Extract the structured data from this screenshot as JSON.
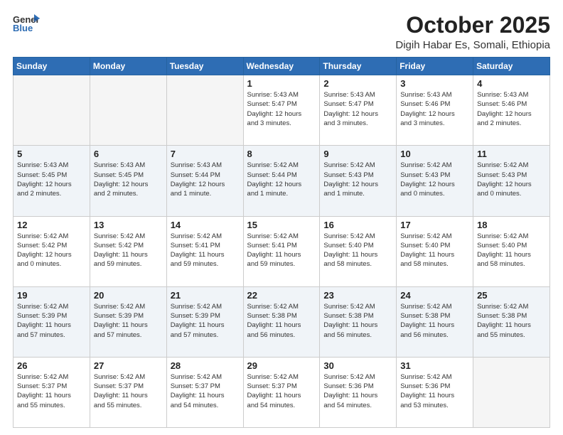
{
  "header": {
    "logo_general": "General",
    "logo_blue": "Blue",
    "month": "October 2025",
    "location": "Digih Habar Es, Somali, Ethiopia"
  },
  "weekdays": [
    "Sunday",
    "Monday",
    "Tuesday",
    "Wednesday",
    "Thursday",
    "Friday",
    "Saturday"
  ],
  "weeks": [
    [
      {
        "day": "",
        "info": ""
      },
      {
        "day": "",
        "info": ""
      },
      {
        "day": "",
        "info": ""
      },
      {
        "day": "1",
        "info": "Sunrise: 5:43 AM\nSunset: 5:47 PM\nDaylight: 12 hours\nand 3 minutes."
      },
      {
        "day": "2",
        "info": "Sunrise: 5:43 AM\nSunset: 5:47 PM\nDaylight: 12 hours\nand 3 minutes."
      },
      {
        "day": "3",
        "info": "Sunrise: 5:43 AM\nSunset: 5:46 PM\nDaylight: 12 hours\nand 3 minutes."
      },
      {
        "day": "4",
        "info": "Sunrise: 5:43 AM\nSunset: 5:46 PM\nDaylight: 12 hours\nand 2 minutes."
      }
    ],
    [
      {
        "day": "5",
        "info": "Sunrise: 5:43 AM\nSunset: 5:45 PM\nDaylight: 12 hours\nand 2 minutes."
      },
      {
        "day": "6",
        "info": "Sunrise: 5:43 AM\nSunset: 5:45 PM\nDaylight: 12 hours\nand 2 minutes."
      },
      {
        "day": "7",
        "info": "Sunrise: 5:43 AM\nSunset: 5:44 PM\nDaylight: 12 hours\nand 1 minute."
      },
      {
        "day": "8",
        "info": "Sunrise: 5:42 AM\nSunset: 5:44 PM\nDaylight: 12 hours\nand 1 minute."
      },
      {
        "day": "9",
        "info": "Sunrise: 5:42 AM\nSunset: 5:43 PM\nDaylight: 12 hours\nand 1 minute."
      },
      {
        "day": "10",
        "info": "Sunrise: 5:42 AM\nSunset: 5:43 PM\nDaylight: 12 hours\nand 0 minutes."
      },
      {
        "day": "11",
        "info": "Sunrise: 5:42 AM\nSunset: 5:43 PM\nDaylight: 12 hours\nand 0 minutes."
      }
    ],
    [
      {
        "day": "12",
        "info": "Sunrise: 5:42 AM\nSunset: 5:42 PM\nDaylight: 12 hours\nand 0 minutes."
      },
      {
        "day": "13",
        "info": "Sunrise: 5:42 AM\nSunset: 5:42 PM\nDaylight: 11 hours\nand 59 minutes."
      },
      {
        "day": "14",
        "info": "Sunrise: 5:42 AM\nSunset: 5:41 PM\nDaylight: 11 hours\nand 59 minutes."
      },
      {
        "day": "15",
        "info": "Sunrise: 5:42 AM\nSunset: 5:41 PM\nDaylight: 11 hours\nand 59 minutes."
      },
      {
        "day": "16",
        "info": "Sunrise: 5:42 AM\nSunset: 5:40 PM\nDaylight: 11 hours\nand 58 minutes."
      },
      {
        "day": "17",
        "info": "Sunrise: 5:42 AM\nSunset: 5:40 PM\nDaylight: 11 hours\nand 58 minutes."
      },
      {
        "day": "18",
        "info": "Sunrise: 5:42 AM\nSunset: 5:40 PM\nDaylight: 11 hours\nand 58 minutes."
      }
    ],
    [
      {
        "day": "19",
        "info": "Sunrise: 5:42 AM\nSunset: 5:39 PM\nDaylight: 11 hours\nand 57 minutes."
      },
      {
        "day": "20",
        "info": "Sunrise: 5:42 AM\nSunset: 5:39 PM\nDaylight: 11 hours\nand 57 minutes."
      },
      {
        "day": "21",
        "info": "Sunrise: 5:42 AM\nSunset: 5:39 PM\nDaylight: 11 hours\nand 57 minutes."
      },
      {
        "day": "22",
        "info": "Sunrise: 5:42 AM\nSunset: 5:38 PM\nDaylight: 11 hours\nand 56 minutes."
      },
      {
        "day": "23",
        "info": "Sunrise: 5:42 AM\nSunset: 5:38 PM\nDaylight: 11 hours\nand 56 minutes."
      },
      {
        "day": "24",
        "info": "Sunrise: 5:42 AM\nSunset: 5:38 PM\nDaylight: 11 hours\nand 56 minutes."
      },
      {
        "day": "25",
        "info": "Sunrise: 5:42 AM\nSunset: 5:38 PM\nDaylight: 11 hours\nand 55 minutes."
      }
    ],
    [
      {
        "day": "26",
        "info": "Sunrise: 5:42 AM\nSunset: 5:37 PM\nDaylight: 11 hours\nand 55 minutes."
      },
      {
        "day": "27",
        "info": "Sunrise: 5:42 AM\nSunset: 5:37 PM\nDaylight: 11 hours\nand 55 minutes."
      },
      {
        "day": "28",
        "info": "Sunrise: 5:42 AM\nSunset: 5:37 PM\nDaylight: 11 hours\nand 54 minutes."
      },
      {
        "day": "29",
        "info": "Sunrise: 5:42 AM\nSunset: 5:37 PM\nDaylight: 11 hours\nand 54 minutes."
      },
      {
        "day": "30",
        "info": "Sunrise: 5:42 AM\nSunset: 5:36 PM\nDaylight: 11 hours\nand 54 minutes."
      },
      {
        "day": "31",
        "info": "Sunrise: 5:42 AM\nSunset: 5:36 PM\nDaylight: 11 hours\nand 53 minutes."
      },
      {
        "day": "",
        "info": ""
      }
    ]
  ]
}
